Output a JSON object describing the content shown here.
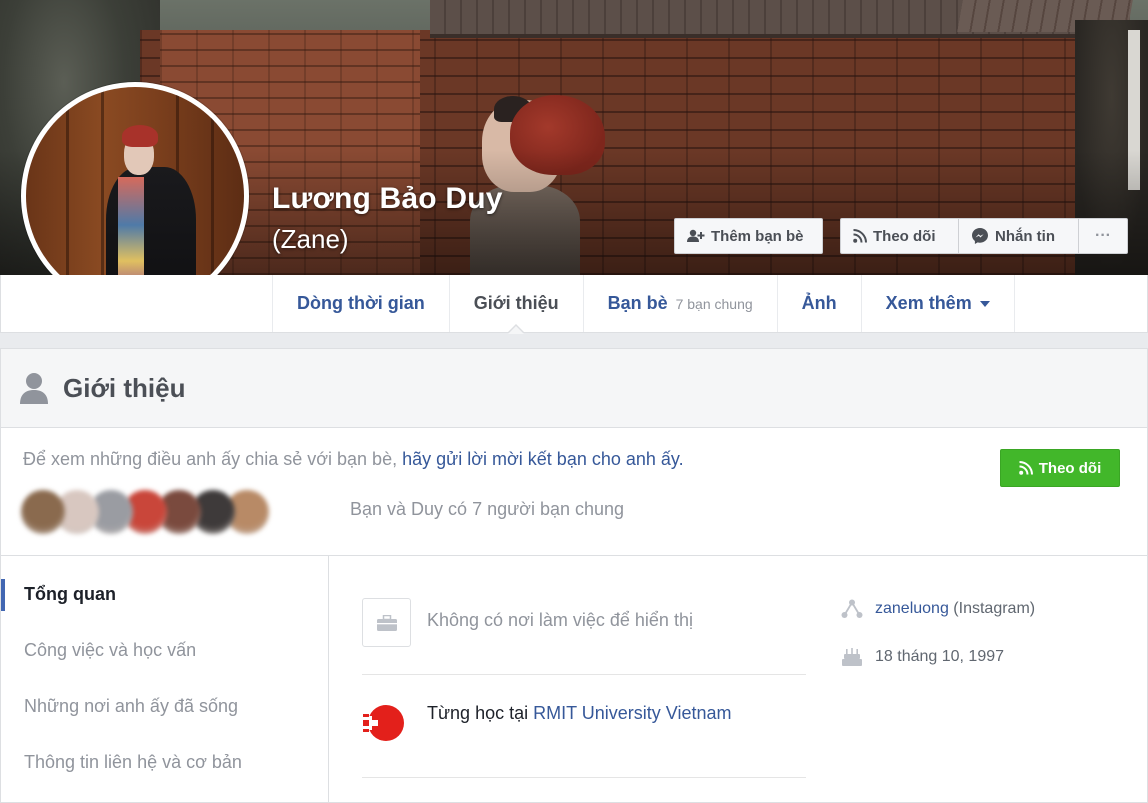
{
  "profile": {
    "name": "Lương Bảo Duy",
    "alternate_name": "(Zane)"
  },
  "cover_actions": {
    "add_friend": "Thêm bạn bè",
    "follow": "Theo dõi",
    "message": "Nhắn tin",
    "more": "···"
  },
  "tabs": [
    {
      "label": "Dòng thời gian",
      "active": false
    },
    {
      "label": "Giới thiệu",
      "active": true
    },
    {
      "label": "Bạn bè",
      "count": "7 bạn chung",
      "active": false
    },
    {
      "label": "Ảnh",
      "active": false
    },
    {
      "label": "Xem thêm",
      "active": false
    }
  ],
  "intro": {
    "title": "Giới thiệu",
    "add_prompt_prefix": "Để xem những điều anh ấy chia sẻ với bạn bè,",
    "add_prompt_link": "hãy gửi lời mời kết bạn cho anh ấy.",
    "follow_button": "Theo dõi",
    "mutual_text": "Bạn và Duy có 7 người bạn chung",
    "mutual_friend_colors": [
      "#8a6a4e",
      "#d8c7c0",
      "#9a9ca2",
      "#c9463a",
      "#7a4a3e",
      "#3e3a3a",
      "#b88a66"
    ]
  },
  "about_nav": [
    {
      "label": "Tổng quan",
      "active": true
    },
    {
      "label": "Công việc và học vấn",
      "active": false
    },
    {
      "label": "Những nơi anh ấy đã sống",
      "active": false
    },
    {
      "label": "Thông tin liên hệ và cơ bản",
      "active": false
    }
  ],
  "overview": {
    "work_empty": "Không có nơi làm việc để hiển thị",
    "education_prefix": "Từng học tại",
    "education_school": "RMIT University Vietnam",
    "instagram_handle": "zaneluong",
    "instagram_label": "(Instagram)",
    "birthday": "18 tháng 10, 1997"
  },
  "colors": {
    "link": "#365899",
    "muted": "#90949c",
    "follow_green": "#42b72a",
    "rmit_red": "#e3201b"
  }
}
